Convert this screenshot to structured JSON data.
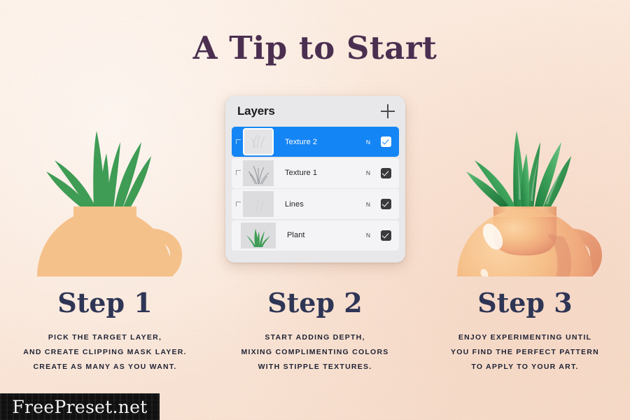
{
  "page": {
    "title": "A Tip to Start",
    "background_color": "#fbeade",
    "title_color": "#4b2f50",
    "heading_color": "#2e3555",
    "body_color": "#1e2235",
    "accent_color": "#1485f5",
    "vase_color": "#f5c18a",
    "plant_color": "#3e9c54"
  },
  "steps": [
    {
      "heading": "Step 1",
      "lines": [
        "PICK THE TARGET LAYER,",
        "AND CREATE CLIPPING MASK LAYER.",
        "CREATE AS MANY AS YOU WANT."
      ]
    },
    {
      "heading": "Step 2",
      "lines": [
        "START ADDING DEPTH,",
        "MIXING COMPLIMENTING COLORS",
        "WITH STIPPLE TEXTURES."
      ]
    },
    {
      "heading": "Step 3",
      "lines": [
        "ENJOY EXPERIMENTING UNTIL",
        "YOU FIND THE PERFECT PATTERN",
        "TO APPLY TO YOUR ART."
      ]
    }
  ],
  "layers_panel": {
    "title": "Layers",
    "add_button_icon": "plus-icon",
    "rows": [
      {
        "name": "Texture 2",
        "blend_mode": "N",
        "visible": true,
        "selected": true,
        "clipped": true,
        "thumbnail": "faint-sketch"
      },
      {
        "name": "Texture 1",
        "blend_mode": "N",
        "visible": true,
        "selected": false,
        "clipped": true,
        "thumbnail": "grass-sketch"
      },
      {
        "name": "Lines",
        "blend_mode": "N",
        "visible": true,
        "selected": false,
        "clipped": true,
        "thumbnail": "blank-gray"
      },
      {
        "name": "Plant",
        "blend_mode": "N",
        "visible": true,
        "selected": false,
        "clipped": false,
        "thumbnail": "green-plant"
      }
    ]
  },
  "watermark": {
    "text": "FreePreset.net"
  }
}
